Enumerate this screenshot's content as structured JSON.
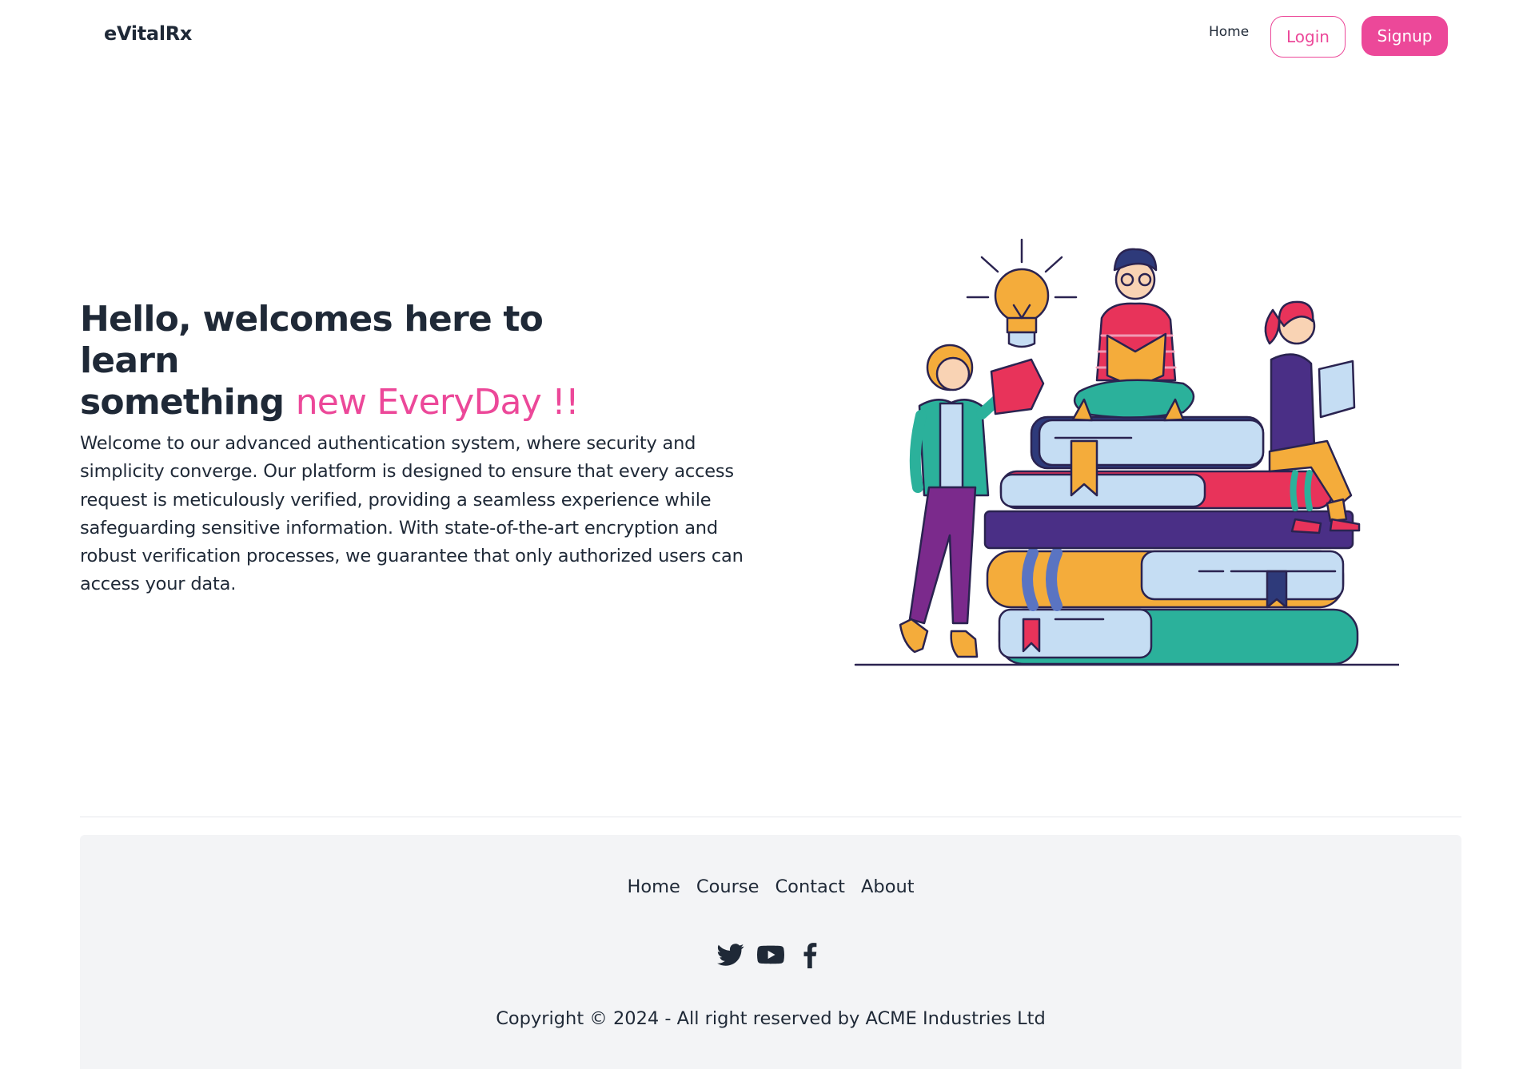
{
  "header": {
    "brand": "eVitalRx",
    "nav_home": "Home",
    "login_label": "Login",
    "signup_label": "Signup"
  },
  "hero": {
    "title_line1": "Hello, welcomes here to learn",
    "title_line2_start": "something ",
    "title_highlight": "new EveryDay !!",
    "description": "Welcome to our advanced authentication system, where security and simplicity converge. Our platform is designed to ensure that every access request is meticulously verified, providing a seamless experience while safeguarding sensitive information. With state-of-the-art encryption and robust verification processes, we guarantee that only authorized users can access your data.",
    "illustration_icon": "reading-people-books-illustration"
  },
  "footer": {
    "links": [
      "Home",
      "Course",
      "Contact",
      "About"
    ],
    "social_icons": [
      "twitter-icon",
      "youtube-icon",
      "facebook-icon"
    ],
    "copyright": "Copyright © 2024 - All right reserved by ACME Industries Ltd"
  },
  "colors": {
    "accent": "#ec4899",
    "text": "#1f2937",
    "footer_bg": "#f3f4f6",
    "divider": "#e5e7eb"
  }
}
